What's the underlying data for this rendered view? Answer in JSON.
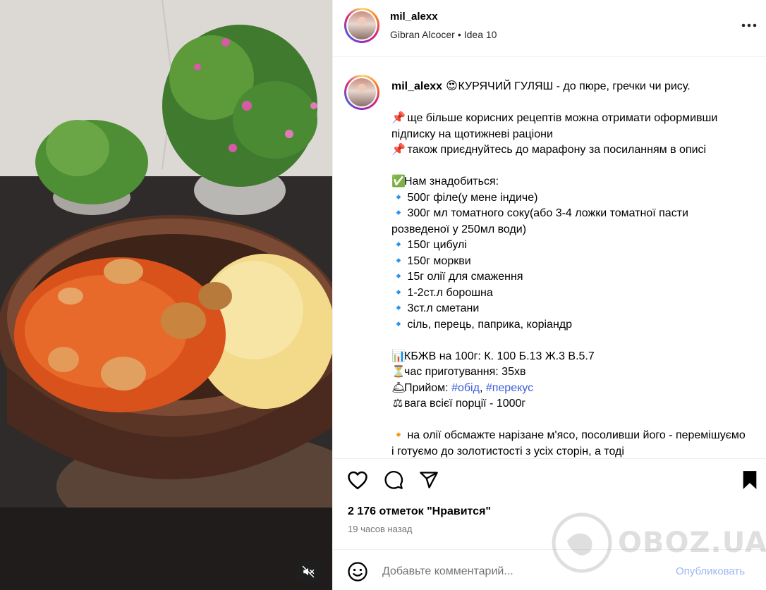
{
  "post": {
    "username": "mil_alexx",
    "subline": {
      "audio_artist": "Gibran Alcocer",
      "audio_title": "Idea 10"
    }
  },
  "caption": {
    "username": "mil_alexx",
    "title": "КУРЯЧИЙ ГУЛЯШ - до пюре, гречки чи рису.",
    "lines": [
      {
        "icon": "📌",
        "text": "ще більше корисних рецептів можна отримати оформивши підписку на щотижневі раціони"
      },
      {
        "icon": "📌",
        "text": "також приєднуйтесь до марафону за посиланням в описі"
      }
    ],
    "ingredients_title": "Нам знадобиться:",
    "ingredients": [
      "500г філе(у мене індиче)",
      "300г мл томатного соку(або 3-4 ложки томатної пасти розведеної у 250мл води)",
      "150г цибулі",
      "150г моркви",
      "15г олії для смаження",
      "1-2ст.л борошна",
      "3ст.л сметани",
      "сіль, перець, паприка, коріандр"
    ],
    "nutrition": "КБЖВ на 100г: К. 100 Б.13 Ж.3 В.5.7",
    "cook_time": "час приготування: 35хв",
    "meal_label": "Прийом:",
    "meal_tags": [
      "#обід",
      "#перекус"
    ],
    "meal_separator": ", ",
    "weight": "вага всієї порції - 1000г",
    "step1": "на олії обсмажте нарізане м'ясо, посоливши його - перемішуємо і готуємо до золотистості з усіх сторін, а тоді"
  },
  "engagement": {
    "likes": "2 176 отметок \"Нравится\"",
    "time_ago": "19 часов назад"
  },
  "comment": {
    "placeholder": "Добавьте комментарий...",
    "publish_label": "Опубликовать"
  },
  "watermark": {
    "text": "OBOZ.UA"
  },
  "icons": {
    "more": "more-horizontal-icon",
    "like": "heart-icon",
    "comment": "comment-bubble-icon",
    "share": "paper-plane-icon",
    "save": "bookmark-icon",
    "emoji": "smiley-icon",
    "mute": "speaker-muted-icon"
  },
  "colors": {
    "accent_link": "#3b5bdb",
    "publish_disabled": "#9ab8f5",
    "secondary_text": "#737373",
    "divider": "#efefef"
  }
}
